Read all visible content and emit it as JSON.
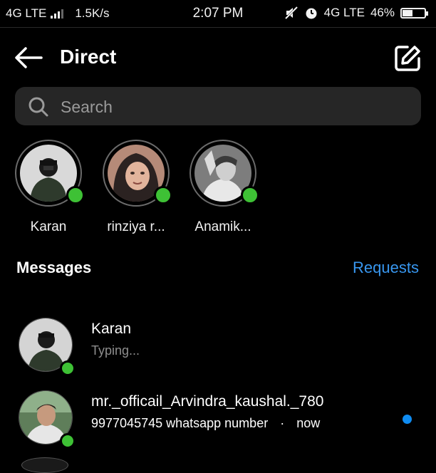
{
  "colors": {
    "background": "#000000",
    "online": "#3ec135",
    "accent_blue": "#3897f0",
    "unread": "#0f8cf2",
    "muted": "#8e8e8e"
  },
  "status_bar": {
    "network_left": "4G LTE",
    "speed": "1.5K/s",
    "time": "2:07 PM",
    "network_right": "4G LTE",
    "battery": "46%",
    "battery_level": 0.46,
    "icons": [
      "signal-icon",
      "mute-icon",
      "alarm-icon",
      "battery-icon"
    ]
  },
  "header": {
    "title": "Direct",
    "back_icon": "arrow-left-icon",
    "compose_icon": "compose-icon"
  },
  "search": {
    "placeholder": "Search",
    "value": ""
  },
  "stories": [
    {
      "name": "Karan",
      "online": true
    },
    {
      "name": "rinziya r...",
      "online": true
    },
    {
      "name": "Anamik...",
      "online": true
    }
  ],
  "messages_section": {
    "label": "Messages",
    "requests": "Requests"
  },
  "threads": [
    {
      "name": "Karan",
      "subtitle": "Typing...",
      "online": true,
      "unread": false
    },
    {
      "name": "mr._officail_Arvindra_kaushal._780",
      "preview": "9977045745 whatsapp number",
      "separator": "·",
      "time": "now",
      "online": true,
      "unread": true
    }
  ]
}
